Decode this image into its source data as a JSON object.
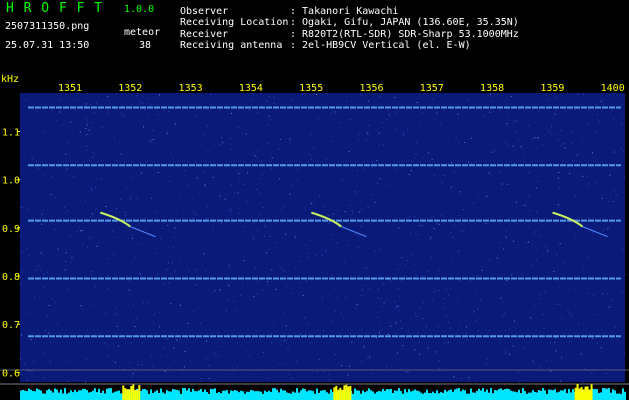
{
  "app": {
    "name": "H R O F F T",
    "version": "1.0.0"
  },
  "file": {
    "name": "2507311350.png",
    "datetime": "25.07.31 13:50"
  },
  "detection": {
    "label": "meteor",
    "count": "38"
  },
  "meta": {
    "labels": [
      "Observer",
      "Receiving Location",
      "Receiver",
      "Receiving antenna"
    ],
    "values": [
      ": Takanori Kawachi",
      ": Ogaki, Gifu, JAPAN (136.60E, 35.35N)",
      ": R820T2(RTL-SDR) SDR-Sharp 53.1000MHz",
      ": 2el-HB9CV Vertical (el. E-W)"
    ]
  },
  "chart_data": {
    "type": "heatmap",
    "ylabel": "kHz",
    "x_ticks": [
      "1351",
      "1352",
      "1353",
      "1354",
      "1355",
      "1356",
      "1357",
      "1358",
      "1359",
      "1400"
    ],
    "y_ticks": [
      "1.1",
      "1.0",
      "0.9",
      "0.8",
      "0.7",
      "0.6"
    ],
    "ylim": [
      0.58,
      1.18
    ],
    "carrier_lines_khz": [
      1.15,
      1.03,
      0.915,
      0.795,
      0.675
    ],
    "echo_times": [
      "1352",
      "1355.5",
      "1359.5"
    ]
  },
  "colors": {
    "background": "#000000",
    "spectrum": "#0a1a78",
    "carrier": "#5fb0ff",
    "axis_text": "#ffff00",
    "header_text": "#ffffff",
    "app_text": "#00ff00",
    "power_fill": "#00e5ff",
    "power_peak": "#ffff00"
  }
}
